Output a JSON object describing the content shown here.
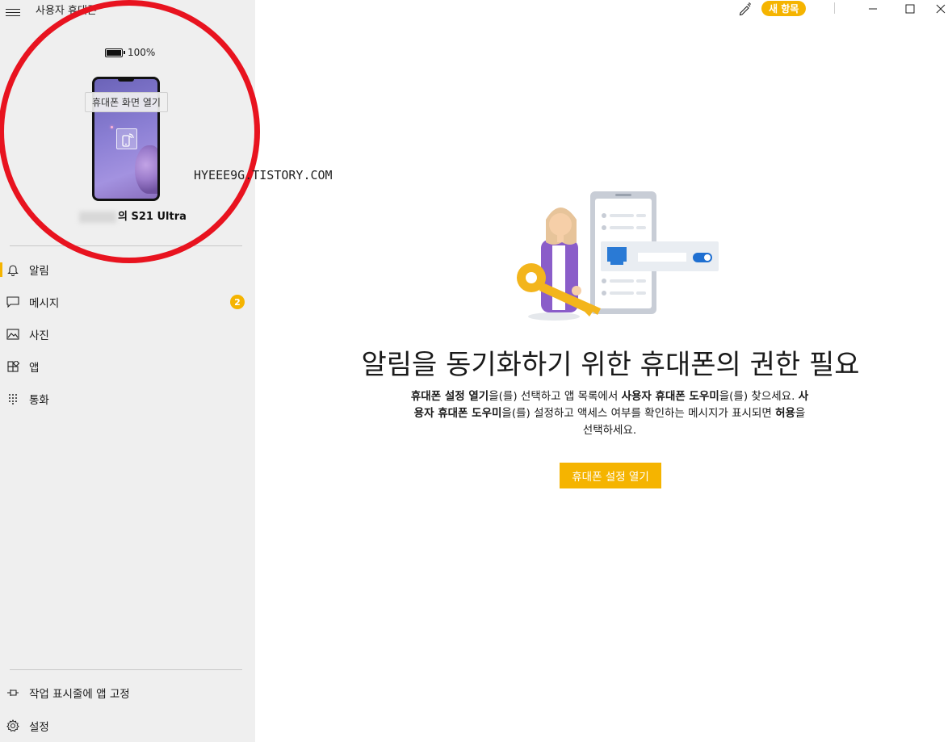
{
  "app": {
    "title": "사용자 휴대폰",
    "new_items_label": "새 항목"
  },
  "device": {
    "battery": "100%",
    "open_screen_label": "휴대폰 화면 열기",
    "name_suffix": "의 S21 Ultra"
  },
  "nav": {
    "items": [
      {
        "label": "알림",
        "icon": "bell-icon"
      },
      {
        "label": "메시지",
        "icon": "message-icon",
        "badge": "2"
      },
      {
        "label": "사진",
        "icon": "photo-icon"
      },
      {
        "label": "앱",
        "icon": "apps-icon"
      },
      {
        "label": "통화",
        "icon": "dialpad-icon"
      }
    ],
    "bottom": [
      {
        "label": "작업 표시줄에 앱 고정",
        "icon": "pin-icon"
      },
      {
        "label": "설정",
        "icon": "gear-icon"
      }
    ]
  },
  "watermark": "HYEEE9G.TISTORY.COM",
  "main": {
    "heading": "알림을 동기화하기 위한 휴대폰의 권한 필요",
    "desc": {
      "b1": "휴대폰 설정 열기",
      "t1": "을(를) 선택하고 앱 목록에서 ",
      "b2": "사용자 휴대폰 도우미",
      "t2": "을(를) 찾으세요. ",
      "b3": "사용자 휴대폰 도우미",
      "t3": "을(를) 설정하고 액세스 여부를 확인하는 메시지가 표시되면 ",
      "b4": "허용",
      "t4": "을 선택하세요."
    },
    "button_label": "휴대폰 설정 열기"
  },
  "colors": {
    "accent": "#f5b400",
    "sidebar_bg": "#efefef",
    "annotation_red": "#e8131f"
  }
}
